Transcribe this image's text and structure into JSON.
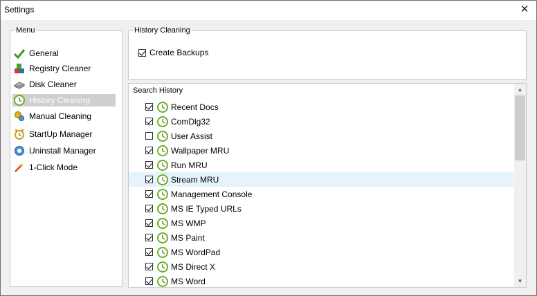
{
  "window": {
    "title": "Settings",
    "close_glyph": "✕"
  },
  "menu": {
    "legend": "Menu",
    "items": [
      {
        "label": "General",
        "icon": "checkmark-icon"
      },
      {
        "label": "Registry Cleaner",
        "icon": "registry-cubes-icon"
      },
      {
        "label": "Disk Cleaner",
        "icon": "disk-icon"
      },
      {
        "label": "History Cleaning",
        "icon": "clock-icon",
        "selected": true
      },
      {
        "label": "Manual Cleaning",
        "icon": "gears-icon"
      },
      {
        "label": "StartUp Manager",
        "icon": "startup-clock-icon"
      },
      {
        "label": "Uninstall Manager",
        "icon": "uninstall-icon"
      },
      {
        "label": "1-Click Mode",
        "icon": "magic-wand-icon"
      }
    ]
  },
  "history_cleaning": {
    "legend": "History Cleaning",
    "create_backups": {
      "label": "Create Backups",
      "checked": true
    }
  },
  "search_history": {
    "title": "Search History",
    "items": [
      {
        "label": "Recent Docs",
        "checked": true
      },
      {
        "label": "ComDlg32",
        "checked": true
      },
      {
        "label": "User Assist",
        "checked": false
      },
      {
        "label": "Wallpaper MRU",
        "checked": true
      },
      {
        "label": "Run MRU",
        "checked": true
      },
      {
        "label": "Stream MRU",
        "checked": true,
        "highlighted": true
      },
      {
        "label": "Management Console",
        "checked": true
      },
      {
        "label": "MS IE Typed URLs",
        "checked": true
      },
      {
        "label": "MS WMP",
        "checked": true
      },
      {
        "label": "MS Paint",
        "checked": true
      },
      {
        "label": "MS WordPad",
        "checked": true
      },
      {
        "label": "MS Direct X",
        "checked": true
      },
      {
        "label": "MS Word",
        "checked": true
      }
    ]
  },
  "scrollbar": {
    "up_glyph": "▲",
    "down_glyph": "▼"
  },
  "colors": {
    "selection": "#cfcfcf",
    "row_highlight": "#e5f3fb",
    "clock_green": "#6ab023"
  }
}
